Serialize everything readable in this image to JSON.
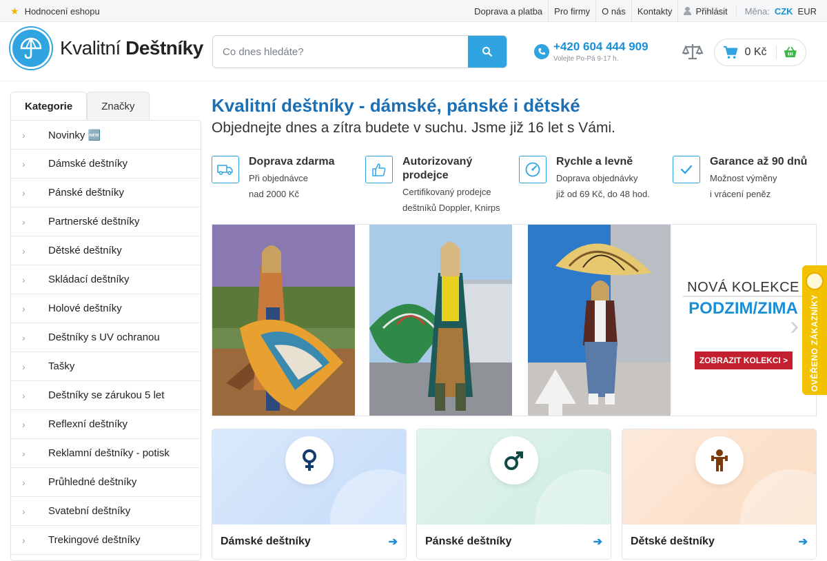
{
  "topbar": {
    "rating_label": "Hodnocení eshopu",
    "links": [
      "Doprava a platba",
      "Pro firmy",
      "O nás",
      "Kontakty"
    ],
    "login_label": "Přihlásit",
    "currency_label": "Měna:",
    "currencies": [
      "CZK",
      "EUR"
    ],
    "active_currency": "CZK"
  },
  "header": {
    "logo_regular": "Kvalitní ",
    "logo_bold": "Deštníky",
    "search_placeholder": "Co dnes hledáte?",
    "phone_number": "+420 604 444 909",
    "phone_hours": "Volejte Po-Pá 9-17 h.",
    "cart_total": "0 Kč"
  },
  "sidebar": {
    "tabs": [
      {
        "label": "Kategorie",
        "active": true
      },
      {
        "label": "Značky",
        "active": false
      }
    ],
    "items": [
      {
        "label": "Novinky 🆕"
      },
      {
        "label": "Dámské deštníky"
      },
      {
        "label": "Pánské deštníky"
      },
      {
        "label": "Partnerské deštníky"
      },
      {
        "label": "Dětské deštníky"
      },
      {
        "label": "Skládací deštníky"
      },
      {
        "label": "Holové deštníky"
      },
      {
        "label": "Deštníky s UV ochranou"
      },
      {
        "label": "Tašky"
      },
      {
        "label": "Deštníky se zárukou 5 let"
      },
      {
        "label": "Reflexní deštníky"
      },
      {
        "label": "Reklamní deštníky - potisk"
      },
      {
        "label": "Průhledné deštníky"
      },
      {
        "label": "Svatební deštníky"
      },
      {
        "label": "Trekingové deštníky"
      }
    ]
  },
  "main": {
    "title": "Kvalitní deštníky - dámské, pánské i dětské",
    "subtitle": "Objednejte dnes a zítra budete v suchu. Jsme již 16 let s Vámi.",
    "usps": [
      {
        "icon": "truck-icon",
        "title": "Doprava zdarma",
        "line1": "Při objednávce",
        "line2": "nad 2000 Kč"
      },
      {
        "icon": "thumbs-up-icon",
        "title": "Autorizovaný prodejce",
        "line1": "Certifikovaný prodejce",
        "line2": "deštníků Doppler, Knirps"
      },
      {
        "icon": "speedometer-icon",
        "title": "Rychle a levně",
        "line1": "Doprava objednávky",
        "line2": "již od 69 Kč, do 48 hod."
      },
      {
        "icon": "checkmark-icon",
        "title": "Garance až 90 dnů",
        "line1": "Možnost výměny",
        "line2": "i vrácení peněz"
      }
    ],
    "banner": {
      "line1": "NOVÁ KOLEKCE",
      "line2": "PODZIM/ZIMA",
      "button": "ZOBRAZIT KOLEKCI >"
    },
    "verified_badge": "OVĚŘENO ZÁKAZNÍKY",
    "categories": [
      {
        "label": "Dámské deštníky",
        "icon": "female-icon",
        "color": "#d7e7fb"
      },
      {
        "label": "Pánské deštníky",
        "icon": "male-icon",
        "color": "#d9f1ea"
      },
      {
        "label": "Dětské deštníky",
        "icon": "child-icon",
        "color": "#fde6d3"
      }
    ]
  },
  "colors": {
    "brand_blue": "#2fa4e0",
    "link_blue": "#1a8fd6",
    "banner_red": "#c3202f",
    "badge_yellow": "#f2c200"
  }
}
